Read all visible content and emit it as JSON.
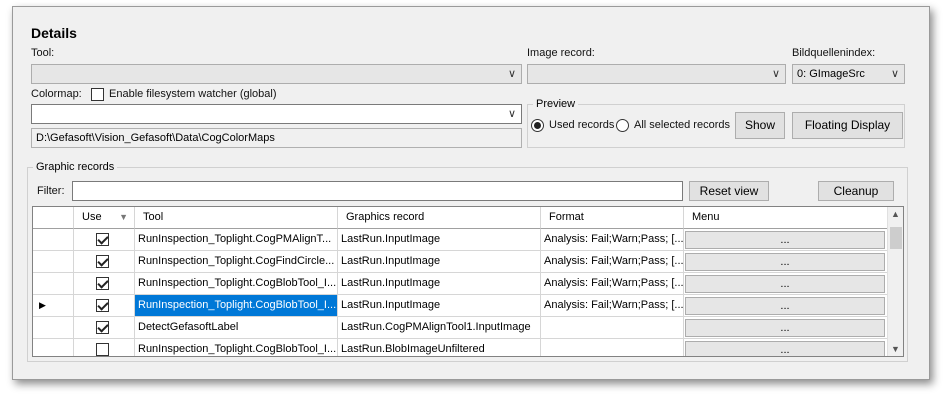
{
  "details": {
    "title": "Details",
    "tool_label": "Tool:",
    "tool_value": "",
    "image_record_label": "Image record:",
    "image_record_value": "",
    "bildquellenindex_label": "Bildquellenindex:",
    "bildquellenindex_value": "0: GImageSrc",
    "colormap_label": "Colormap:",
    "fs_watcher_label": "Enable filesystem watcher (global)",
    "fs_watcher_checked": false,
    "colormap_value": "",
    "colormap_path": "D:\\Gefasoft\\Vision_Gefasoft\\Data\\CogColorMaps"
  },
  "preview": {
    "group_label": "Preview",
    "used_records_label": "Used records",
    "all_selected_label": "All selected records",
    "selected": "used_records",
    "show_button": "Show",
    "floating_button": "Floating Display"
  },
  "graphic_records": {
    "group_label": "Graphic records",
    "filter_label": "Filter:",
    "filter_value": "",
    "reset_button": "Reset view",
    "cleanup_button": "Cleanup",
    "columns": [
      "Use",
      "Tool",
      "Graphics record",
      "Format",
      "Menu"
    ],
    "rows": [
      {
        "use": true,
        "tool": "RunInspection_Toplight.CogPMAlignT...",
        "record": "LastRun.InputImage",
        "format": "Analysis: Fail;Warn;Pass; [...",
        "menu": "...",
        "current": false,
        "selected": false
      },
      {
        "use": true,
        "tool": "RunInspection_Toplight.CogFindCircle...",
        "record": "LastRun.InputImage",
        "format": "Analysis: Fail;Warn;Pass; [...",
        "menu": "...",
        "current": false,
        "selected": false
      },
      {
        "use": true,
        "tool": "RunInspection_Toplight.CogBlobTool_I...",
        "record": "LastRun.InputImage",
        "format": "Analysis: Fail;Warn;Pass; [...",
        "menu": "...",
        "current": false,
        "selected": false
      },
      {
        "use": true,
        "tool": "RunInspection_Toplight.CogBlobTool_I...",
        "record": "LastRun.InputImage",
        "format": "Analysis: Fail;Warn;Pass; [...",
        "menu": "...",
        "current": true,
        "selected": true
      },
      {
        "use": true,
        "tool": "DetectGefasoftLabel",
        "record": "LastRun.CogPMAlignTool1.InputImage",
        "format": "",
        "menu": "...",
        "current": false,
        "selected": false
      },
      {
        "use": false,
        "tool": "RunInspection_Toplight.CogBlobTool_I...",
        "record": "LastRun.BlobImageUnfiltered",
        "format": "",
        "menu": "...",
        "current": false,
        "selected": false
      }
    ]
  },
  "colors": {
    "selection": "#0078d7",
    "panel": "#f0f0f0"
  }
}
